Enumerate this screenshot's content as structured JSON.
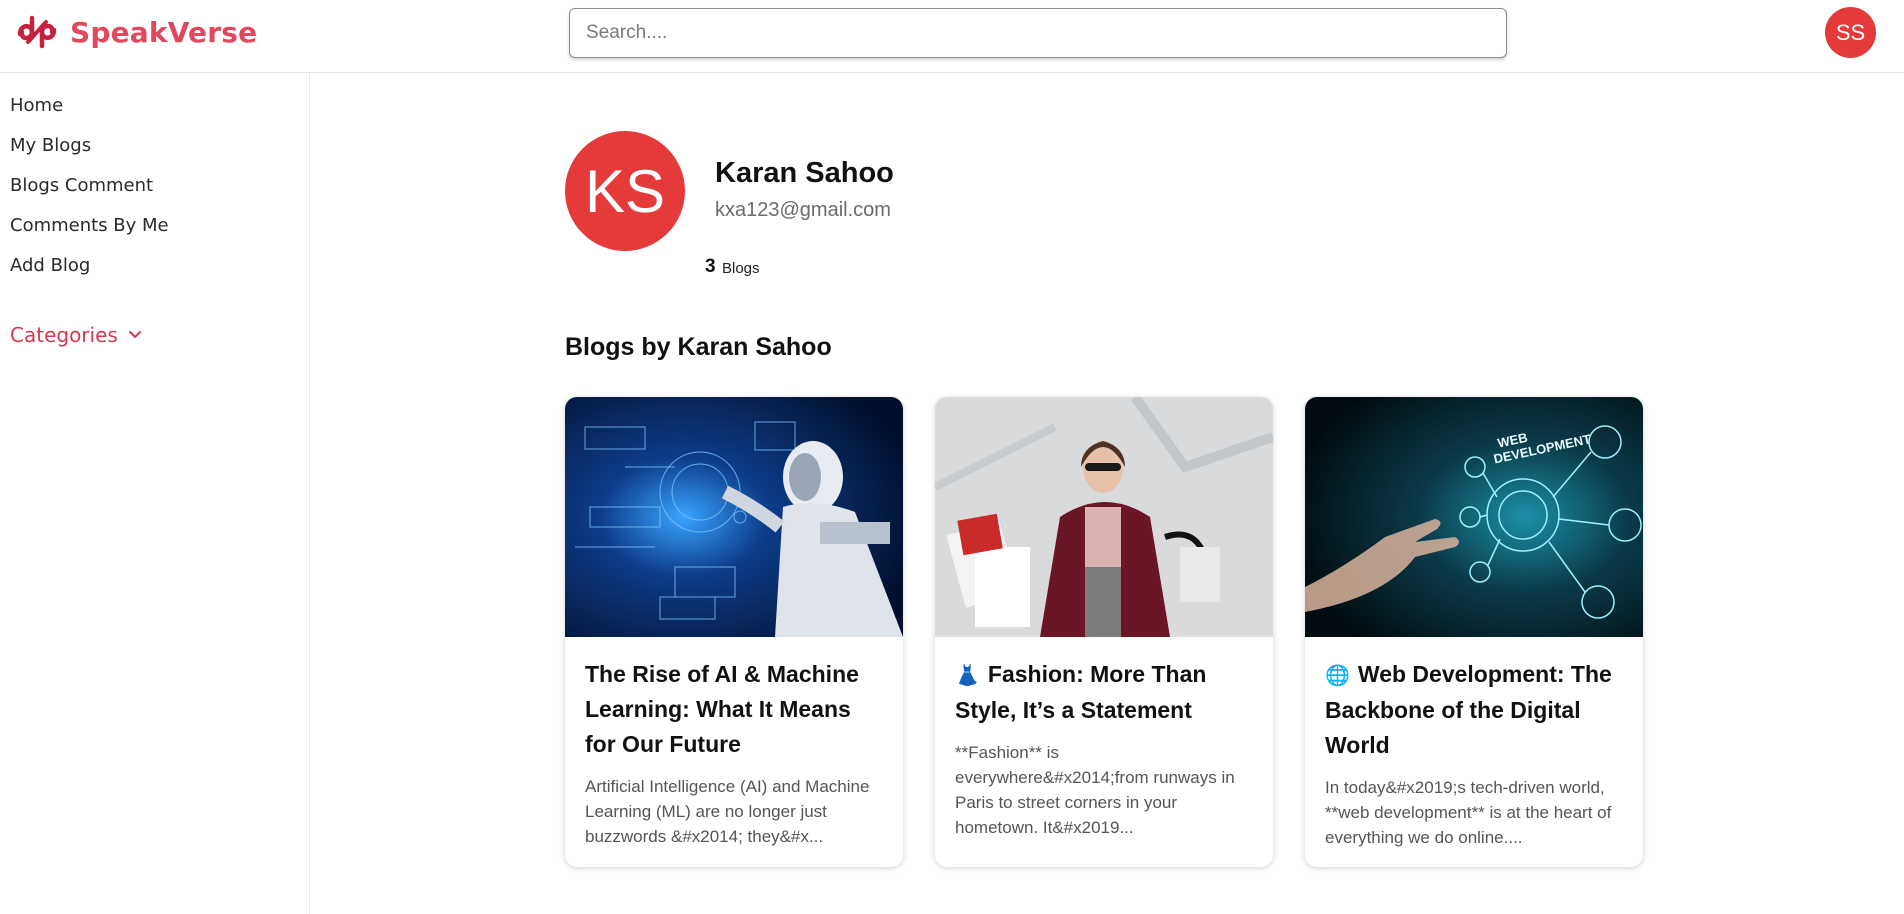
{
  "header": {
    "brand": "SpeakVerse",
    "search_placeholder": "Search....",
    "user_initials": "SS"
  },
  "sidebar": {
    "items": [
      {
        "label": "Home"
      },
      {
        "label": "My Blogs"
      },
      {
        "label": "Blogs Comment"
      },
      {
        "label": "Comments By Me"
      },
      {
        "label": "Add Blog"
      }
    ],
    "categories_label": "Categories"
  },
  "profile": {
    "initials": "KS",
    "name": "Karan Sahoo",
    "email": "kxa123@gmail.com",
    "blog_count": "3",
    "blog_count_label": "Blogs"
  },
  "section_title": "Blogs by Karan Sahoo",
  "cards": [
    {
      "emoji": "",
      "title": "The Rise of AI & Machine Learning: What It Means for Our Future",
      "excerpt": "Artificial Intelligence (AI) and Machine Learning (ML) are no longer just buzzwords &#x2014; they&#x..."
    },
    {
      "emoji": "👗",
      "title": "Fashion: More Than Style, It’s a Statement",
      "excerpt": "**Fashion** is everywhere&#x2014;from runways in Paris to street corners in your hometown. It&#x2019..."
    },
    {
      "emoji": "🌐",
      "title": "Web Development: The Backbone of the Digital World",
      "excerpt": "In today&#x2019;s tech-driven world, **web development** is at the heart of everything we do online...."
    }
  ],
  "card3_image_text": [
    "WEB",
    "DEVELOPMENT"
  ],
  "colors": {
    "brand": "#e04860",
    "avatar": "#e53a3a",
    "categories": "#d23a52"
  }
}
